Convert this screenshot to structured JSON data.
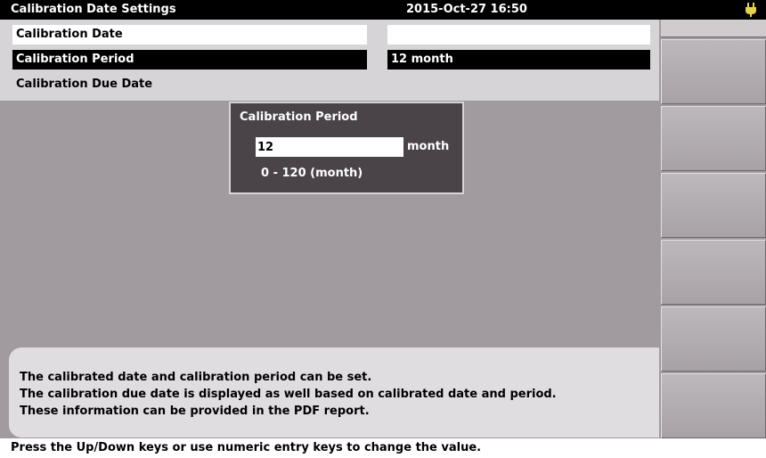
{
  "titlebar": {
    "title": "Calibration Date Settings",
    "datetime": "2015-Oct-27 16:50"
  },
  "settings": {
    "rows": [
      {
        "label": "Calibration Date",
        "value": ""
      },
      {
        "label": "Calibration Period",
        "value": "12 month"
      },
      {
        "label": "Calibration Due Date",
        "value": ""
      }
    ]
  },
  "dialog": {
    "title": "Calibration Period",
    "input_value": "12",
    "unit": "month",
    "range": "0 - 120 (month)"
  },
  "info": {
    "lines": [
      "The calibrated date and calibration period can be set.",
      "The calibration due date is displayed as well based on calibrated date and period.",
      "These information can be provided in the PDF report."
    ]
  },
  "statusbar": {
    "hint": "Press the Up/Down keys or use numeric entry keys to change the value."
  },
  "colors": {
    "selected_bg": "#000000",
    "panel_bg": "#d7d4d7",
    "main_bg": "#a19b9f",
    "dialog_bg": "#4a4347"
  },
  "icons": {
    "plug": "power-plug-icon"
  }
}
